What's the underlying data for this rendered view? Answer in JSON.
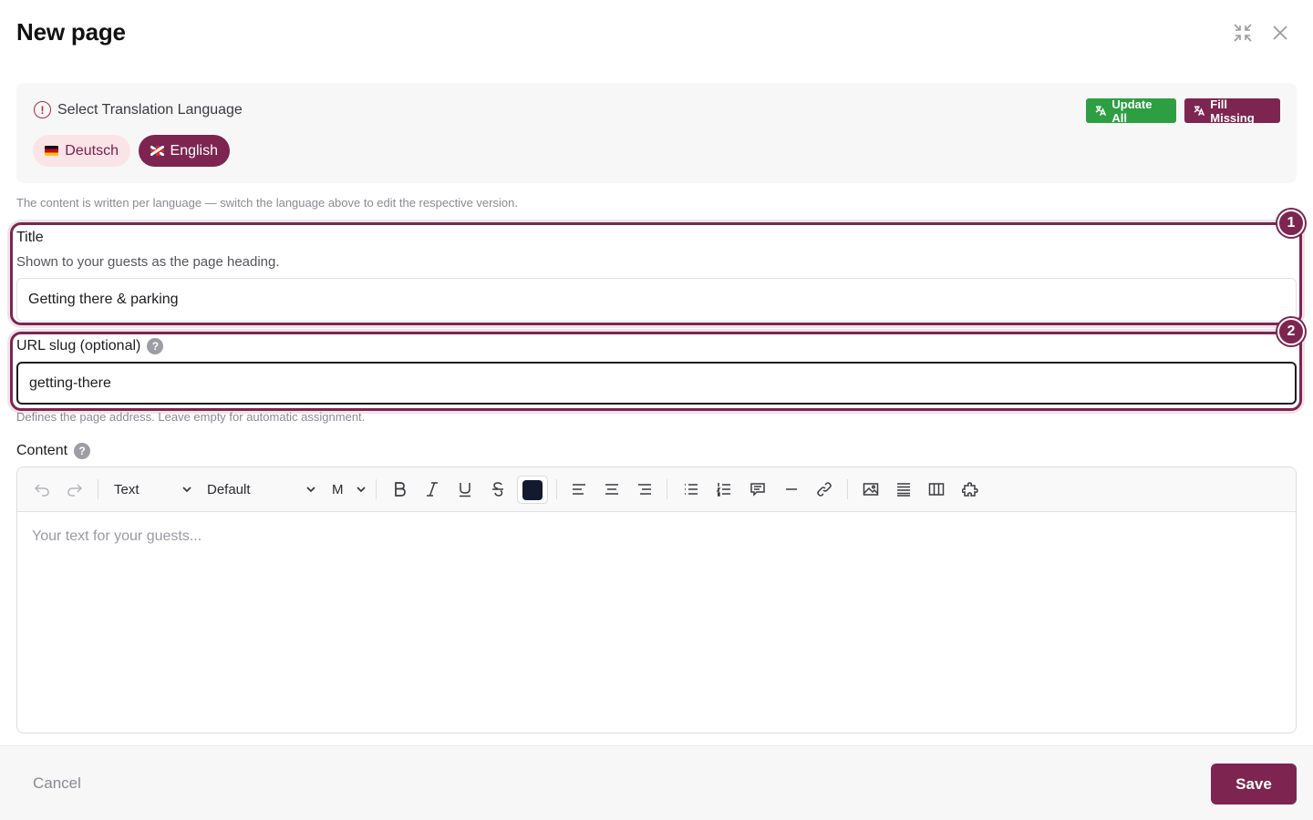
{
  "header": {
    "title": "New page",
    "icons": {
      "collapse": "collapse-icon",
      "close": "close-icon"
    }
  },
  "translation": {
    "heading": "Select Translation Language",
    "languages": [
      {
        "label": "Deutsch",
        "flag": "german-flag-icon",
        "active": false
      },
      {
        "label": "English",
        "flag": "uk-flag-icon",
        "active": true
      }
    ],
    "update_all_label": "Update All",
    "fill_missing_label": "Fill Missing",
    "info": "The content is written per language — switch the language above to edit the respective version."
  },
  "title_field": {
    "label": "Title",
    "help": "Shown to your guests as the page heading.",
    "value": "Getting there & parking",
    "badge": "1"
  },
  "slug_field": {
    "label": "URL slug (optional)",
    "help_icon": "?",
    "value": "getting-there",
    "hint": "Defines the page address. Leave empty for automatic assignment.",
    "badge": "2"
  },
  "content_field": {
    "label": "Content",
    "help_icon": "?",
    "toolbar": {
      "block_type": "Text",
      "font": "Default",
      "size": "M",
      "text_color": "#141a2e"
    },
    "placeholder": "Your text for your guests..."
  },
  "footer": {
    "cancel_label": "Cancel",
    "save_label": "Save"
  },
  "colors": {
    "brand": "#7d2550",
    "update_green": "#2e9e42",
    "alert_red": "#b3263a",
    "language_chip_inactive": "#fbe4e8"
  }
}
